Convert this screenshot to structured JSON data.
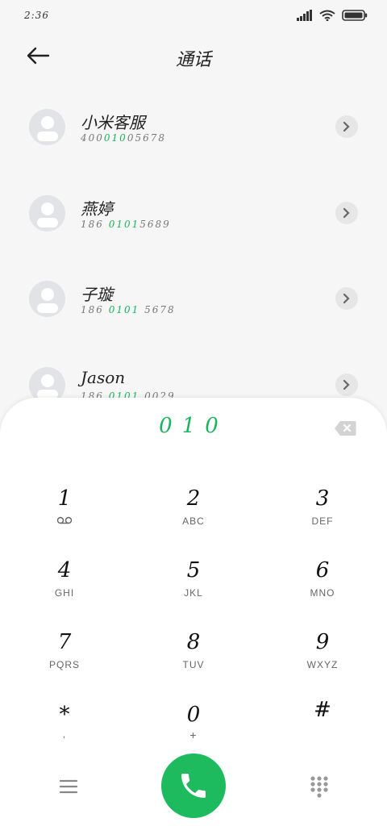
{
  "status_bar": {
    "time": "2:36"
  },
  "header": {
    "title": "通话"
  },
  "contacts": [
    {
      "name": "小米客服",
      "number_pre": "400",
      "number_hl": "010",
      "number_post": "05678"
    },
    {
      "name": "燕婷",
      "number_pre": "186 ",
      "number_hl": "0101",
      "number_post": "5689"
    },
    {
      "name": "子璇",
      "number_pre": "186 ",
      "number_hl": "0101",
      "number_post": " 5678"
    },
    {
      "name": "Jason",
      "number_pre": "186 ",
      "number_hl": "0101",
      "number_post": " 0029"
    }
  ],
  "dialer": {
    "entry": "010",
    "keys": [
      {
        "digit": "1",
        "letters": ""
      },
      {
        "digit": "2",
        "letters": "ABC"
      },
      {
        "digit": "3",
        "letters": "DEF"
      },
      {
        "digit": "4",
        "letters": "GHI"
      },
      {
        "digit": "5",
        "letters": "JKL"
      },
      {
        "digit": "6",
        "letters": "MNO"
      },
      {
        "digit": "7",
        "letters": "PQRS"
      },
      {
        "digit": "8",
        "letters": "TUV"
      },
      {
        "digit": "9",
        "letters": "WXYZ"
      },
      {
        "digit": "*",
        "letters": ","
      },
      {
        "digit": "0",
        "letters": "+"
      },
      {
        "digit": "#",
        "letters": ""
      }
    ]
  },
  "colors": {
    "accent": "#1bb35b",
    "call_button": "#1dbb5e"
  }
}
